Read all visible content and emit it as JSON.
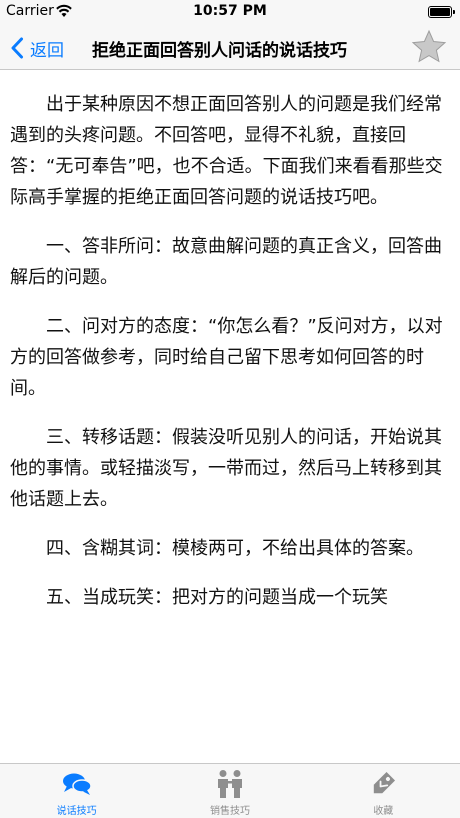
{
  "status_bar": {
    "carrier": "Carrier",
    "time": "10:57 PM",
    "wifi_icon": "wifi-icon",
    "battery_icon": "battery-icon"
  },
  "nav_bar": {
    "back_label": "返回",
    "back_icon": "chevron-left-icon",
    "title": "拒绝正面回答别人问话的说话技巧",
    "star_icon": "star-icon"
  },
  "article": {
    "paragraphs": [
      "出于某种原因不想正面回答别人的问题是我们经常遇到的头疼问题。不回答吧，显得不礼貌，直接回答：“无可奉告”吧，也不合适。下面我们来看看那些交际高手掌握的拒绝正面回答问题的说话技巧吧。",
      "一、答非所问：故意曲解问题的真正含义，回答曲解后的问题。",
      "二、问对方的态度：“你怎么看？”反问对方，以对方的回答做参考，同时给自己留下思考如何回答的时间。",
      "三、转移话题：假装没听见别人的问话，开始说其他的事情。或轻描淡写，一带而过，然后马上转移到其他话题上去。",
      "四、含糊其词：模棱两可，不给出具体的答案。",
      "五、当成玩笑：把对方的问题当成一个玩笑"
    ]
  },
  "tab_bar": {
    "tabs": [
      {
        "label": "说话技巧",
        "icon": "speech-bubbles-icon",
        "active": true
      },
      {
        "label": "销售技巧",
        "icon": "people-icon",
        "active": false
      },
      {
        "label": "收藏",
        "icon": "tag-icon",
        "active": false
      }
    ]
  },
  "colors": {
    "accent": "#0a7cff",
    "inactive": "#8e8e8e",
    "bar_background": "#f7f7f7",
    "star_fill": "#c8c8c8"
  }
}
